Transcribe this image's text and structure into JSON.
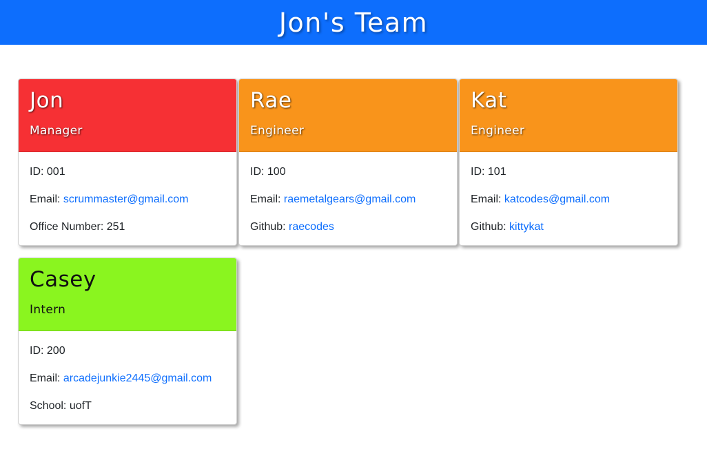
{
  "page": {
    "title": "Jon's Team",
    "header_color": "#0d6efd"
  },
  "colors": {
    "manager": "#f63034",
    "engineer": "#f9941b",
    "intern": "#8af51f",
    "link": "#0d6efd"
  },
  "cards": [
    {
      "name": "Jon",
      "role": "Manager",
      "id_label": "ID:",
      "id": "001",
      "email_label": "Email:",
      "email": "scrummaster@gmail.com",
      "extra_label": "Office Number:",
      "extra": "251"
    },
    {
      "name": "Rae",
      "role": "Engineer",
      "id_label": "ID:",
      "id": "100",
      "email_label": "Email:",
      "email": "raemetalgears@gmail.com",
      "extra_label": "Github:",
      "extra": "raecodes"
    },
    {
      "name": "Kat",
      "role": "Engineer",
      "id_label": "ID:",
      "id": "101",
      "email_label": "Email:",
      "email": "katcodes@gmail.com",
      "extra_label": "Github:",
      "extra": "kittykat"
    },
    {
      "name": "Casey",
      "role": "Intern",
      "id_label": "ID:",
      "id": "200",
      "email_label": "Email:",
      "email": "arcadejunkie2445@gmail.com",
      "extra_label": "School:",
      "extra": "uofT"
    }
  ]
}
